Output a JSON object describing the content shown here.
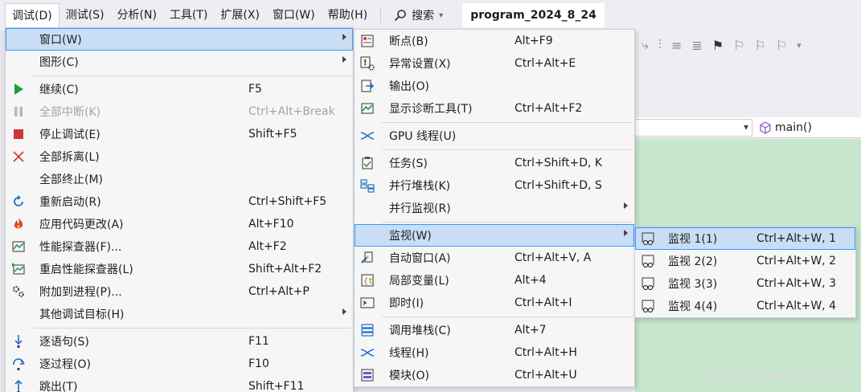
{
  "menubar": {
    "items": [
      "调试(D)",
      "测试(S)",
      "分析(N)",
      "工具(T)",
      "扩展(X)",
      "窗口(W)",
      "帮助(H)"
    ],
    "search_label": "搜索",
    "project_title": "program_2024_8_24"
  },
  "editor": {
    "function_label": "main()"
  },
  "watermark": "CSDN @TANGLONG222",
  "debug_menu": {
    "items": [
      {
        "label": "窗口(W)",
        "shortcut": "",
        "icon": "none",
        "submenu": true,
        "selected": true
      },
      {
        "label": "图形(C)",
        "shortcut": "",
        "icon": "none",
        "submenu": true
      },
      {
        "divider": true
      },
      {
        "label": "继续(C)",
        "shortcut": "F5",
        "icon": "play-icon"
      },
      {
        "label": "全部中断(K)",
        "shortcut": "Ctrl+Alt+Break",
        "icon": "pause-icon",
        "disabled": true
      },
      {
        "label": "停止调试(E)",
        "shortcut": "Shift+F5",
        "icon": "stop-icon"
      },
      {
        "label": "全部拆离(L)",
        "shortcut": "",
        "icon": "detach-x-icon"
      },
      {
        "label": "全部终止(M)",
        "shortcut": "",
        "icon": "none"
      },
      {
        "label": "重新启动(R)",
        "shortcut": "Ctrl+Shift+F5",
        "icon": "restart-icon"
      },
      {
        "label": "应用代码更改(A)",
        "shortcut": "Alt+F10",
        "icon": "hot-reload-flame-icon"
      },
      {
        "label": "性能探查器(F)...",
        "shortcut": "Alt+F2",
        "icon": "profiler-icon"
      },
      {
        "label": "重启性能探查器(L)",
        "shortcut": "Shift+Alt+F2",
        "icon": "profiler-restart-icon"
      },
      {
        "label": "附加到进程(P)...",
        "shortcut": "Ctrl+Alt+P",
        "icon": "gears-icon"
      },
      {
        "label": "其他调试目标(H)",
        "shortcut": "",
        "icon": "none",
        "submenu": true
      },
      {
        "divider": true
      },
      {
        "label": "逐语句(S)",
        "shortcut": "F11",
        "icon": "step-into-icon"
      },
      {
        "label": "逐过程(O)",
        "shortcut": "F10",
        "icon": "step-over-icon"
      },
      {
        "label": "跳出(T)",
        "shortcut": "Shift+F11",
        "icon": "step-out-icon"
      }
    ]
  },
  "window_menu": {
    "items": [
      {
        "label": "断点(B)",
        "shortcut": "Alt+F9",
        "icon": "breakpoints-icon"
      },
      {
        "label": "异常设置(X)",
        "shortcut": "Ctrl+Alt+E",
        "icon": "exception-settings-icon"
      },
      {
        "label": "输出(O)",
        "shortcut": "",
        "icon": "output-icon"
      },
      {
        "label": "显示诊断工具(T)",
        "shortcut": "Ctrl+Alt+F2",
        "icon": "diagnostics-icon"
      },
      {
        "divider": true
      },
      {
        "label": "GPU 线程(U)",
        "shortcut": "",
        "icon": "threads-icon"
      },
      {
        "divider": true
      },
      {
        "label": "任务(S)",
        "shortcut": "Ctrl+Shift+D, K",
        "icon": "tasks-icon"
      },
      {
        "label": "并行堆栈(K)",
        "shortcut": "Ctrl+Shift+D, S",
        "icon": "parallel-stacks-icon"
      },
      {
        "label": "并行监视(R)",
        "shortcut": "",
        "icon": "none",
        "submenu": true
      },
      {
        "divider": true
      },
      {
        "label": "监视(W)",
        "shortcut": "",
        "icon": "none",
        "submenu": true,
        "selected": true
      },
      {
        "label": "自动窗口(A)",
        "shortcut": "Ctrl+Alt+V, A",
        "icon": "autos-icon"
      },
      {
        "label": "局部变量(L)",
        "shortcut": "Alt+4",
        "icon": "locals-icon"
      },
      {
        "label": "即时(I)",
        "shortcut": "Ctrl+Alt+I",
        "icon": "immediate-window-icon"
      },
      {
        "divider": true
      },
      {
        "label": "调用堆栈(C)",
        "shortcut": "Alt+7",
        "icon": "call-stack-icon"
      },
      {
        "label": "线程(H)",
        "shortcut": "Ctrl+Alt+H",
        "icon": "threads-icon"
      },
      {
        "label": "模块(O)",
        "shortcut": "Ctrl+Alt+U",
        "icon": "modules-icon"
      }
    ]
  },
  "watch_menu": {
    "items": [
      {
        "label": "监视 1(1)",
        "shortcut": "Ctrl+Alt+W, 1",
        "icon": "watch-glasses-icon",
        "selected": true
      },
      {
        "label": "监视 2(2)",
        "shortcut": "Ctrl+Alt+W, 2",
        "icon": "watch-glasses-icon"
      },
      {
        "label": "监视 3(3)",
        "shortcut": "Ctrl+Alt+W, 3",
        "icon": "watch-glasses-icon"
      },
      {
        "label": "监视 4(4)",
        "shortcut": "Ctrl+Alt+W, 4",
        "icon": "watch-glasses-icon"
      }
    ]
  },
  "colors": {
    "selection_bg": "#c9def5",
    "selection_border": "#3399ff",
    "menu_bg": "#f6f6f6",
    "editor_bg": "#c9e7cf",
    "play_green": "#1e9e3a",
    "stop_red": "#d13438",
    "icon_blue": "#1f6fc5"
  }
}
